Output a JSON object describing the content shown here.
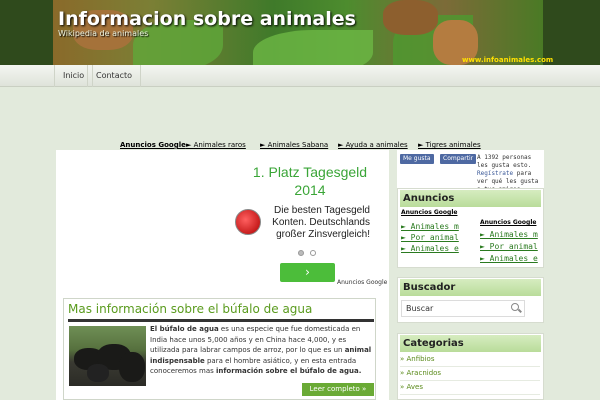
{
  "header": {
    "title": "Informacion sobre animales",
    "tagline": "Wikipedia de animales",
    "url": "www.infoanimales.com"
  },
  "nav": {
    "items": [
      "Inicio",
      "Contacto"
    ]
  },
  "adbar": {
    "label": "Anuncios Google",
    "links": [
      "► Animales raros",
      "► Animales Sabana",
      "► Ayuda a animales",
      "► Tigres animales"
    ]
  },
  "ad": {
    "headline": "1. Platz Tagesgeld 2014",
    "body": "Die besten Tagesgeld Konten. Deutschlands großer Zinsvergleich!",
    "button": "›",
    "google_label": "Anuncios Google"
  },
  "article": {
    "title": "Mas información sobre el búfalo de agua",
    "text_1": "El búfalo de agua",
    "text_2": " es una especie que fue domesticada en India hace unos 5,000 años y en China hace 4,000, y es utilizada para labrar campos de arroz, por lo que es un ",
    "text_3": "animal indispensable",
    "text_4": " para el hombre asiático, y en esta entrada conoceremos mas ",
    "text_5": "información sobre el búfalo de agua.",
    "read_more": "Leer completo »"
  },
  "facebook": {
    "like": "Me gusta",
    "share": "Compartir",
    "text_1": "A 1392 personas les gusta esto.",
    "register": "Regístrate",
    "text_2": " para ver qué les gusta a tus amigos."
  },
  "anuncios": {
    "title": "Anuncios",
    "col1_title": "Anuncios Google",
    "col2_title": "Anuncios Google",
    "col1_links": [
      "► Animales m",
      "► Por animal",
      "► Animales e"
    ],
    "col2_links": [
      "► Animales m",
      "► Por animal",
      "► Animales e"
    ]
  },
  "buscador": {
    "title": "Buscador",
    "placeholder": "Buscar"
  },
  "categorias": {
    "title": "Categorias",
    "items": [
      "» Anfibios",
      "» Aracnidos",
      "» Aves"
    ]
  },
  "colors": {
    "accent_green": "#5a9b1e",
    "ad_green": "#3aa537",
    "facebook_blue": "#4e69a2"
  }
}
